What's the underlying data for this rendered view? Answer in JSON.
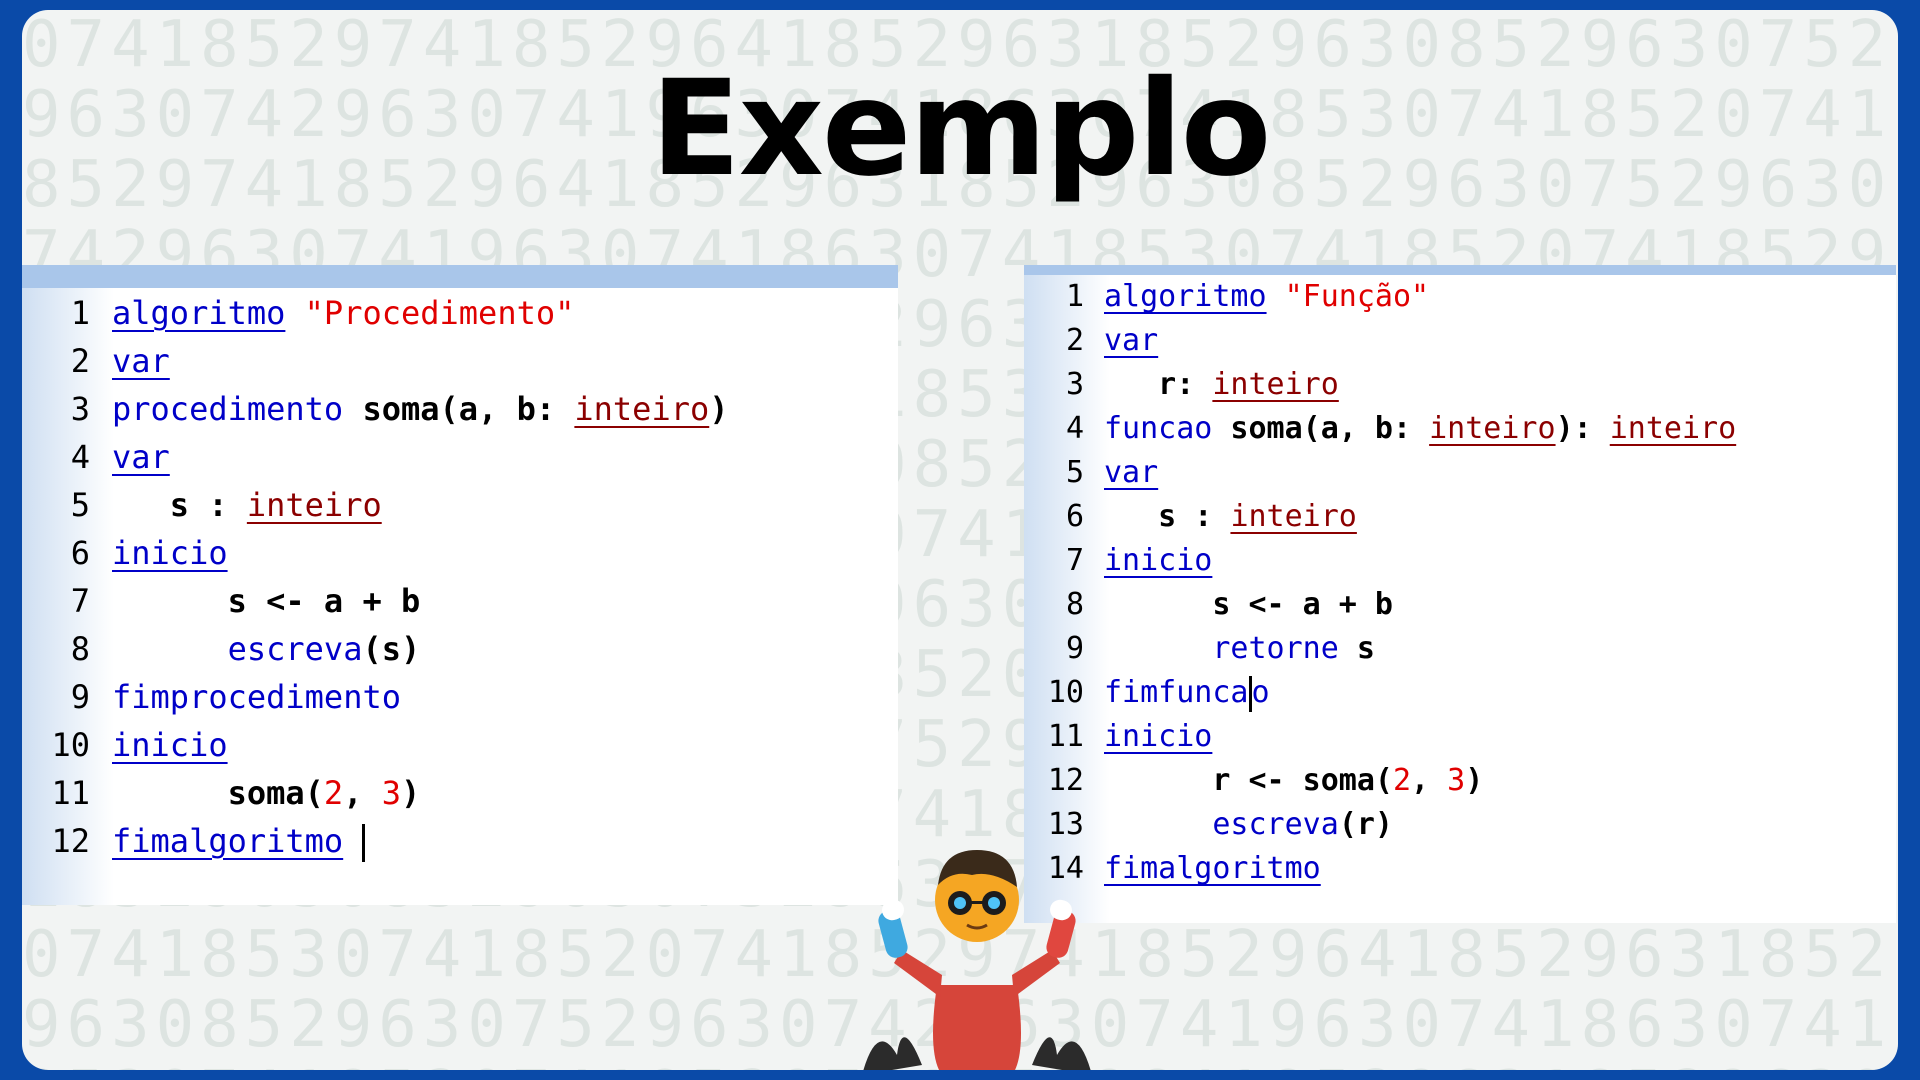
{
  "slide": {
    "title": "Exemplo",
    "colors": {
      "frame": "#0a4aa8",
      "keyword": "#0000c8",
      "type": "#8b0000",
      "string": "#e00000"
    }
  },
  "left_editor": {
    "lines": [
      {
        "n": "1",
        "tokens": [
          {
            "t": "algoritmo",
            "c": "kw"
          },
          {
            "t": " ",
            "c": ""
          },
          {
            "t": "\"Procedimento\"",
            "c": "str"
          }
        ]
      },
      {
        "n": "2",
        "tokens": [
          {
            "t": "var",
            "c": "kw"
          }
        ]
      },
      {
        "n": "3",
        "tokens": [
          {
            "t": "procedimento",
            "c": "kwp"
          },
          {
            "t": " soma(a, b: ",
            "c": "id"
          },
          {
            "t": "inteiro",
            "c": "ty"
          },
          {
            "t": ")",
            "c": "id"
          }
        ]
      },
      {
        "n": "4",
        "tokens": [
          {
            "t": "var",
            "c": "kw"
          }
        ]
      },
      {
        "n": "5",
        "tokens": [
          {
            "t": "   s : ",
            "c": "id"
          },
          {
            "t": "inteiro",
            "c": "ty"
          }
        ]
      },
      {
        "n": "6",
        "tokens": [
          {
            "t": "inicio",
            "c": "kw"
          }
        ]
      },
      {
        "n": "7",
        "tokens": [
          {
            "t": "      s <- a + b",
            "c": "id"
          }
        ]
      },
      {
        "n": "8",
        "tokens": [
          {
            "t": "      ",
            "c": ""
          },
          {
            "t": "escreva",
            "c": "kwp"
          },
          {
            "t": "(s)",
            "c": "id"
          }
        ]
      },
      {
        "n": "9",
        "tokens": [
          {
            "t": "fimprocedimento",
            "c": "kwp"
          }
        ]
      },
      {
        "n": "10",
        "tokens": [
          {
            "t": "inicio",
            "c": "kw"
          }
        ]
      },
      {
        "n": "11",
        "tokens": [
          {
            "t": "      soma(",
            "c": "id"
          },
          {
            "t": "2",
            "c": "num"
          },
          {
            "t": ", ",
            "c": "id"
          },
          {
            "t": "3",
            "c": "num"
          },
          {
            "t": ")",
            "c": "id"
          }
        ]
      },
      {
        "n": "12",
        "tokens": [
          {
            "t": "fimalgoritmo",
            "c": "kw"
          },
          {
            "t": " ",
            "c": ""
          },
          {
            "t": "",
            "c": "caret"
          }
        ]
      }
    ]
  },
  "right_editor": {
    "lines": [
      {
        "n": "1",
        "tokens": [
          {
            "t": "algoritmo",
            "c": "kw"
          },
          {
            "t": " ",
            "c": ""
          },
          {
            "t": "\"Função\"",
            "c": "str"
          }
        ]
      },
      {
        "n": "2",
        "tokens": [
          {
            "t": "var",
            "c": "kw"
          }
        ]
      },
      {
        "n": "3",
        "tokens": [
          {
            "t": "   r: ",
            "c": "id"
          },
          {
            "t": "inteiro",
            "c": "ty"
          }
        ]
      },
      {
        "n": "4",
        "tokens": [
          {
            "t": "funcao",
            "c": "kwp"
          },
          {
            "t": " soma(a, b: ",
            "c": "id"
          },
          {
            "t": "inteiro",
            "c": "ty"
          },
          {
            "t": "): ",
            "c": "id"
          },
          {
            "t": "inteiro",
            "c": "ty"
          }
        ]
      },
      {
        "n": "5",
        "tokens": [
          {
            "t": "var",
            "c": "kw"
          }
        ]
      },
      {
        "n": "6",
        "tokens": [
          {
            "t": "   s : ",
            "c": "id"
          },
          {
            "t": "inteiro",
            "c": "ty"
          }
        ]
      },
      {
        "n": "7",
        "tokens": [
          {
            "t": "inicio",
            "c": "kw"
          }
        ]
      },
      {
        "n": "8",
        "tokens": [
          {
            "t": "      s <- a + b",
            "c": "id"
          }
        ]
      },
      {
        "n": "9",
        "tokens": [
          {
            "t": "      ",
            "c": ""
          },
          {
            "t": "retorne",
            "c": "kwp"
          },
          {
            "t": " s",
            "c": "id"
          }
        ]
      },
      {
        "n": "10",
        "tokens": [
          {
            "t": "fimfunca",
            "c": "kwp"
          },
          {
            "t": "",
            "c": "caret"
          },
          {
            "t": "o",
            "c": "kwp"
          }
        ]
      },
      {
        "n": "11",
        "tokens": [
          {
            "t": "inicio",
            "c": "kw"
          }
        ]
      },
      {
        "n": "12",
        "tokens": [
          {
            "t": "      r <- soma(",
            "c": "id"
          },
          {
            "t": "2",
            "c": "num"
          },
          {
            "t": ", ",
            "c": "id"
          },
          {
            "t": "3",
            "c": "num"
          },
          {
            "t": ")",
            "c": "id"
          }
        ]
      },
      {
        "n": "13",
        "tokens": [
          {
            "t": "      ",
            "c": ""
          },
          {
            "t": "escreva",
            "c": "kwp"
          },
          {
            "t": "(r)",
            "c": "id"
          }
        ]
      },
      {
        "n": "14",
        "tokens": [
          {
            "t": "fimalgoritmo",
            "c": "kw"
          }
        ]
      }
    ]
  },
  "mascot": {
    "icon": "scientist-mascot-icon"
  }
}
